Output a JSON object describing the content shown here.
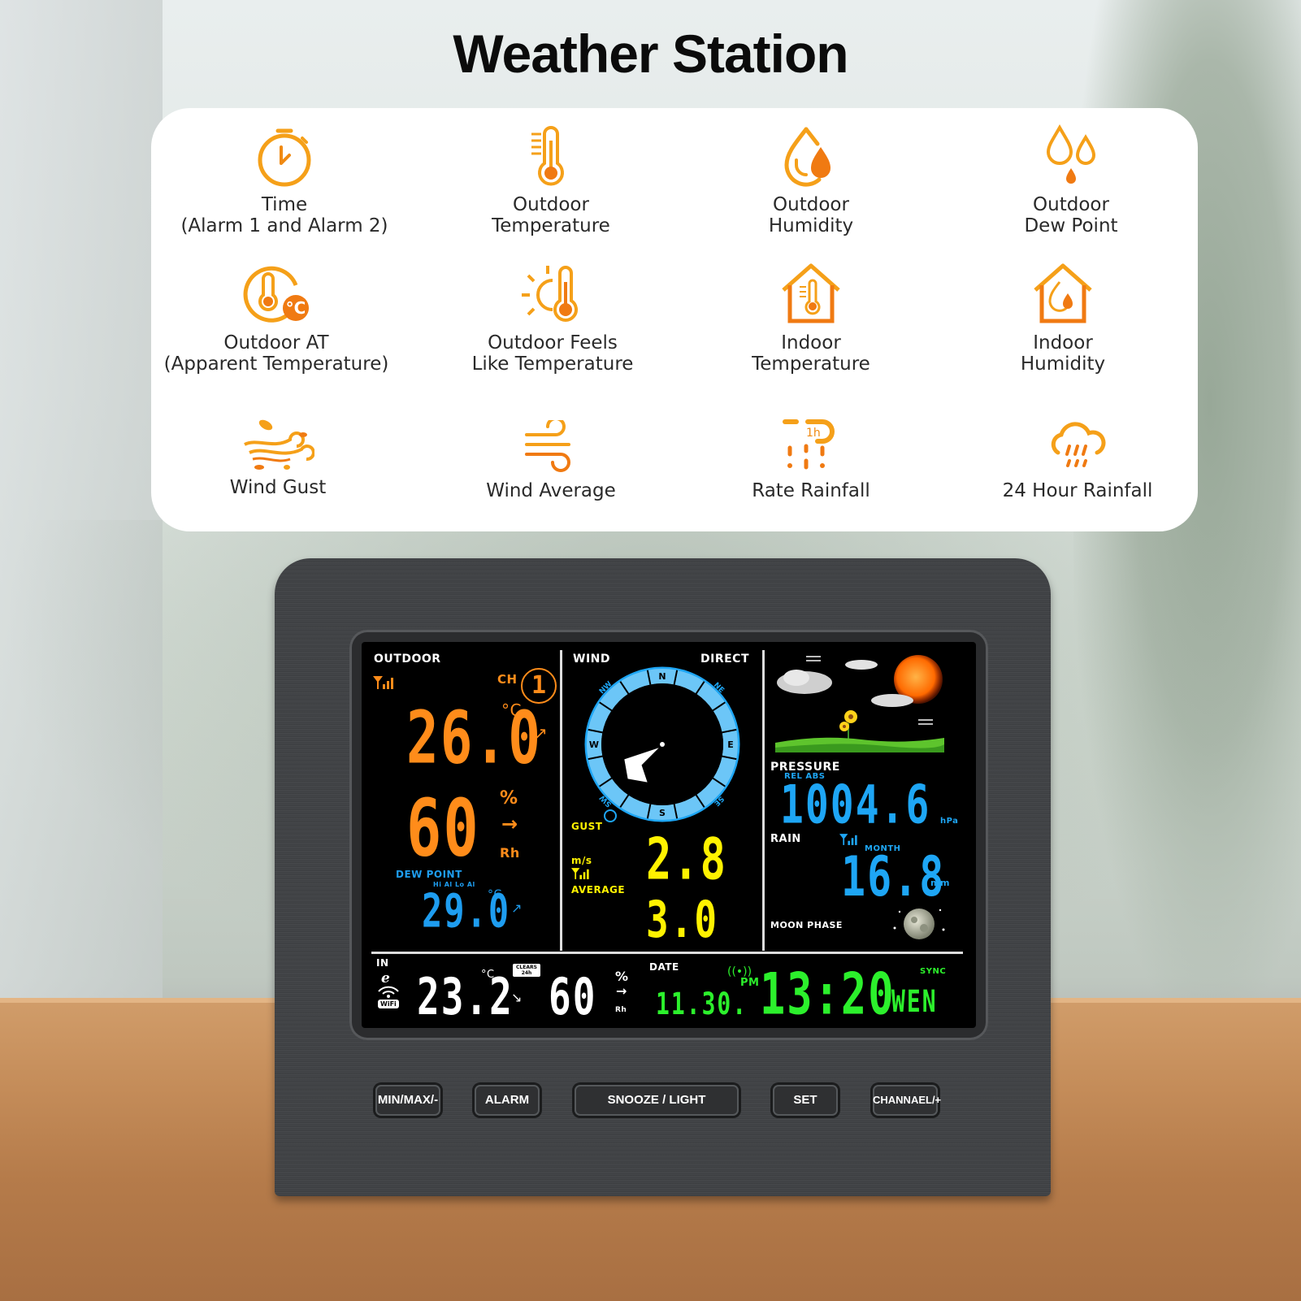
{
  "title": "Weather Station",
  "features": [
    {
      "icon": "stopwatch-icon",
      "line1": "Time",
      "line2": "(Alarm 1 and Alarm 2)"
    },
    {
      "icon": "thermometer-icon",
      "line1": "Outdoor",
      "line2": "Temperature"
    },
    {
      "icon": "humidity-drop-icon",
      "line1": "Outdoor",
      "line2": "Humidity"
    },
    {
      "icon": "dew-drops-icon",
      "line1": "Outdoor",
      "line2": "Dew Point"
    },
    {
      "icon": "apparent-temperature-icon",
      "line1": "Outdoor AT",
      "line2": "(Apparent Temperature)"
    },
    {
      "icon": "sun-thermometer-icon",
      "line1": "Outdoor Feels",
      "line2": "Like Temperature"
    },
    {
      "icon": "house-thermometer-icon",
      "line1": "Indoor",
      "line2": "Temperature"
    },
    {
      "icon": "house-drop-icon",
      "line1": "Indoor",
      "line2": "Humidity"
    },
    {
      "icon": "wind-leaves-icon",
      "line1": "Wind Gust",
      "line2": ""
    },
    {
      "icon": "wind-icon",
      "line1": "Wind Average",
      "line2": ""
    },
    {
      "icon": "rain-rate-icon",
      "line1": "Rate Rainfall",
      "line2": ""
    },
    {
      "icon": "rain-cloud-icon",
      "line1": "24 Hour Rainfall",
      "line2": ""
    }
  ],
  "display": {
    "outdoor": {
      "label": "OUTDOOR",
      "channel_label": "CH",
      "channel": "1",
      "temperature": "26.0",
      "temp_unit": "°C",
      "humidity": "60",
      "humidity_unit": "%",
      "humidity_suffix": "Rh",
      "dew_point_label": "DEW POINT",
      "alarm_label": "Hi Al  Lo Al",
      "dew_point": "29.0",
      "dew_unit": "°C"
    },
    "wind": {
      "label": "WIND",
      "direction_label": "DIRECT",
      "compass": [
        "N",
        "NE",
        "E",
        "SE",
        "S",
        "SW",
        "W",
        "NW"
      ],
      "direction_deg": 225,
      "gust_label": "GUST",
      "gust": "2.8",
      "unit": "m/s",
      "average_label": "AVERAGE",
      "average": "3.0"
    },
    "forecast": {
      "icon": "sunny-cloudy-icon"
    },
    "pressure": {
      "label": "PRESSURE",
      "mode": "REL ABS",
      "value": "1004.6",
      "unit": "hPa"
    },
    "rain": {
      "label": "RAIN",
      "period": "MONTH",
      "value": "16.8",
      "unit": "mm"
    },
    "moon": {
      "label": "MOON PHASE",
      "phase": "full-moon"
    },
    "indoor": {
      "label": "IN",
      "temperature": "23.2",
      "temp_unit": "°C",
      "clears_label": "CLEARS 24h",
      "humidity": "60",
      "humidity_unit": "%",
      "humidity_suffix": "Rh",
      "wifi_label": "WiFi"
    },
    "datetime": {
      "date_label": "DATE",
      "date": "11.30.",
      "ampm": "PM",
      "time": "13:20",
      "sync_label": "SYNC",
      "weekday": "WEN"
    }
  },
  "buttons": {
    "minmax": "MIN/MAX/-",
    "alarm": "ALARM",
    "snooze": "SNOOZE / LIGHT",
    "set": "SET",
    "channel": "CHANNAEL/+"
  },
  "colors": {
    "icon_orange": "#f5a019",
    "icon_deep": "#f07a12",
    "outdoor": "#ff8c1a",
    "dew": "#1e9df0",
    "wind": "#fff200",
    "pressure": "#1ea6f5",
    "clock": "#2cf02c"
  }
}
